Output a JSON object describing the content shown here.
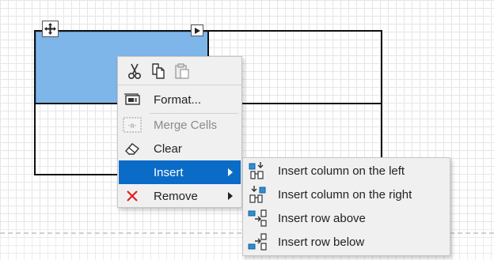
{
  "icons": {
    "move": "move-arrows-icon",
    "column_menu": "play-arrow-icon",
    "cut": "scissors-icon",
    "copy": "copy-icon",
    "paste": "paste-icon"
  },
  "context_menu": {
    "items": [
      {
        "label": "Format...",
        "icon": "format-icon",
        "enabled": true
      },
      {
        "label": "Merge Cells",
        "icon": "merge-cells-icon",
        "enabled": false
      },
      {
        "label": "Clear",
        "icon": "eraser-icon",
        "enabled": true
      },
      {
        "label": "Insert",
        "icon": "",
        "enabled": true,
        "highlighted": true,
        "submenu": true
      },
      {
        "label": "Remove",
        "icon": "red-x-icon",
        "enabled": true,
        "submenu": true
      }
    ]
  },
  "insert_submenu": {
    "items": [
      {
        "label": "Insert column on the left",
        "icon": "insert-column-left-icon"
      },
      {
        "label": "Insert column on the right",
        "icon": "insert-column-right-icon"
      },
      {
        "label": "Insert row above",
        "icon": "insert-row-above-icon"
      },
      {
        "label": "Insert row below",
        "icon": "insert-row-below-icon"
      }
    ]
  },
  "colors": {
    "selected_cell": "#7fb6ea",
    "menu_highlight": "#0b6cc8",
    "remove_icon": "#e02020",
    "insert_icon_blue": "#2b8fd6"
  }
}
